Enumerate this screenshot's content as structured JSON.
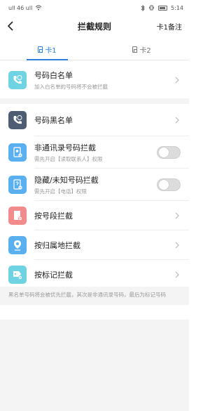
{
  "status_bar": {
    "left_text": "ull 46 ull",
    "time": "5:14"
  },
  "header": {
    "title": "拦截规则",
    "right_label": "卡1备注"
  },
  "tabs": [
    {
      "label": "卡1",
      "active": true
    },
    {
      "label": "卡2",
      "active": false
    }
  ],
  "rows": [
    {
      "label": "号码白名单",
      "sub": "加入白名单的号码将不会被拦截",
      "icon": "phone-smile-icon",
      "color": "#6fd3e3"
    },
    {
      "label": "号码黑名单",
      "sub": "",
      "icon": "phone-sad-icon",
      "color": "#4f5d73"
    },
    {
      "label": "非通讯录号码拦截",
      "sub": "需先开启【读取联系人】权限",
      "icon": "contact-minus-icon",
      "color": "#5ab0ef",
      "toggle": false
    },
    {
      "label": "隐藏/未知号码拦截",
      "sub": "需先开启【电话】权限",
      "icon": "unknown-caller-icon",
      "color": "#5ab0ef",
      "toggle": false
    },
    {
      "label": "按号段拦截",
      "sub": "",
      "icon": "number-segment-icon",
      "color": "#f28b8b"
    },
    {
      "label": "按归属地拦截",
      "sub": "",
      "icon": "location-pin-icon",
      "color": "#5ab0ef"
    },
    {
      "label": "按标记拦截",
      "sub": "",
      "icon": "tag-icon",
      "color": "#6fd3e3"
    }
  ],
  "footer_note": "黑名单号码将会被优先拦截，其次是非通讯录号码，最后为标记号码"
}
